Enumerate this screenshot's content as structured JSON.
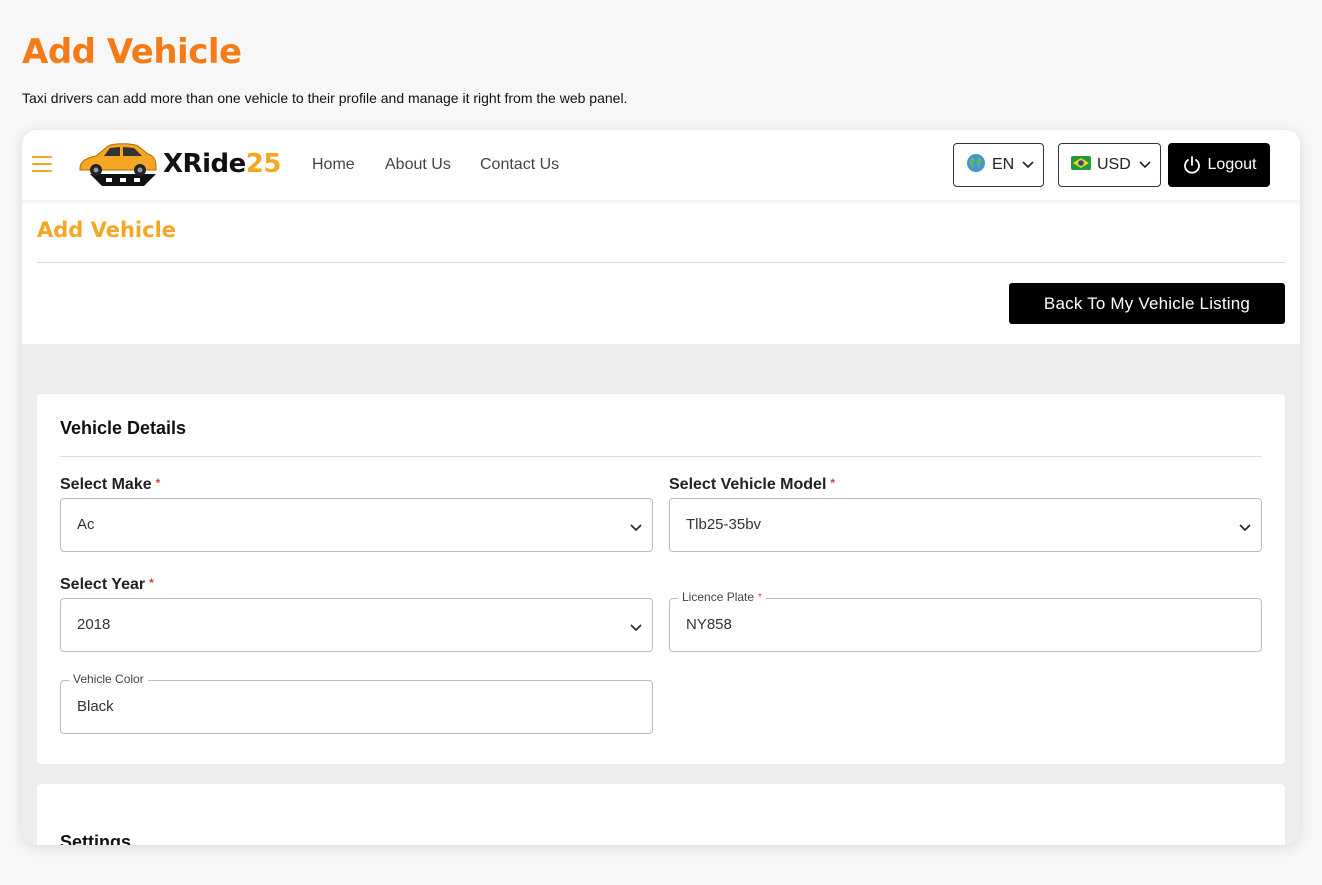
{
  "page": {
    "heading": "Add Vehicle",
    "description": "Taxi drivers can add more than one vehicle to their profile and manage it right from the web panel."
  },
  "navbar": {
    "logo_part1": "XRide",
    "logo_part2": "25",
    "links": [
      "Home",
      "About Us",
      "Contact Us"
    ],
    "language": "EN",
    "currency": "USD",
    "logout_label": "Logout"
  },
  "header": {
    "title": "Add Vehicle",
    "back_button": "Back To My Vehicle Listing"
  },
  "vehicle_details": {
    "title": "Vehicle Details",
    "make": {
      "label": "Select Make",
      "value": "Ac",
      "required": "*"
    },
    "model": {
      "label": "Select Vehicle Model",
      "value": "Tlb25-35bv",
      "required": "*"
    },
    "year": {
      "label": "Select Year",
      "value": "2018",
      "required": "*"
    },
    "plate": {
      "label": "Licence Plate",
      "value": "NY858",
      "required": "*"
    },
    "color": {
      "label": "Vehicle Color",
      "value": "Black"
    }
  },
  "settings": {
    "title": "Settings"
  },
  "colors": {
    "heading_orange": "#f47b16",
    "accent_yellow": "#f5a623",
    "required_red": "#e53935",
    "button_black": "#000000"
  },
  "icons": [
    "hamburger-icon",
    "globe-icon",
    "flag-icon",
    "chevron-down-icon",
    "power-icon"
  ]
}
